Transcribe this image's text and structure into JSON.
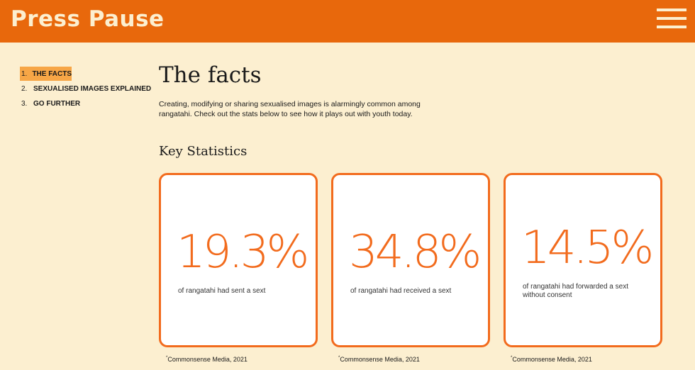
{
  "header": {
    "brand": "Press Pause"
  },
  "toc": {
    "items": [
      {
        "number": "1.",
        "label": "THE FACTS",
        "active": true
      },
      {
        "number": "2.",
        "label": "SEXUALISED IMAGES EXPLAINED",
        "active": false
      },
      {
        "number": "3.",
        "label": "GO FURTHER",
        "active": false
      }
    ]
  },
  "main": {
    "title": "The facts",
    "intro": "Creating, modifying or sharing sexualised images is alarmingly common among rangatahi. Check out the stats below to see how it plays out with youth today.",
    "subtitle": "Key Statistics",
    "cards": [
      {
        "value": "19.3%",
        "description": "of rangatahi had sent a sext",
        "source_mark": "*",
        "source": "Commonsense Media, 2021"
      },
      {
        "value": "34.8%",
        "description": "of rangatahi had received a sext",
        "source_mark": "*",
        "source": "Commonsense Media, 2021"
      },
      {
        "value": "14.5%",
        "description": "of rangatahi had forwarded a sext without consent",
        "source_mark": "*",
        "source": "Commonsense Media, 2021"
      }
    ]
  },
  "colors": {
    "header_bg": "#e8680c",
    "page_bg": "#fcefd0",
    "accent": "#f26b1d",
    "active_highlight": "#f7a646"
  },
  "icons": {
    "menu": "hamburger-menu-icon"
  }
}
